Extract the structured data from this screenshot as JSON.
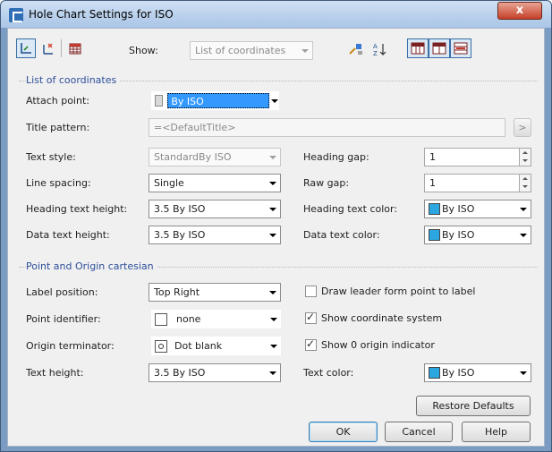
{
  "window": {
    "title": "Hole Chart Settings for ISO",
    "close_label": "x"
  },
  "toolbar": {
    "show_label": "Show:",
    "show_value": "List of coordinates",
    "sort_label": "A Z"
  },
  "section1": {
    "title": "List of coordinates",
    "attach_point": {
      "label": "Attach point:",
      "value": "By ISO"
    },
    "title_pattern": {
      "label": "Title pattern:",
      "value": "=<DefaultTitle>",
      "btn": ">"
    },
    "text_style": {
      "label": "Text style:",
      "value": "StandardBy ISO"
    },
    "heading_gap": {
      "label": "Heading gap:",
      "value": "1"
    },
    "line_spacing": {
      "label": "Line spacing:",
      "value": "Single"
    },
    "raw_gap": {
      "label": "Raw gap:",
      "value": "1"
    },
    "heading_text_height": {
      "label": "Heading text height:",
      "value": "3.5 By ISO"
    },
    "heading_text_color": {
      "label": "Heading text color:",
      "value": "By ISO",
      "color": "#2aa7e0"
    },
    "data_text_height": {
      "label": "Data text height:",
      "value": "3.5 By ISO"
    },
    "data_text_color": {
      "label": "Data text color:",
      "value": "By ISO",
      "color": "#2aa7e0"
    }
  },
  "section2": {
    "title": "Point and Origin cartesian",
    "label_position": {
      "label": "Label position:",
      "value": "Top Right"
    },
    "draw_leader": {
      "label": "Draw leader form point to label",
      "checked": false
    },
    "point_identifier": {
      "label": "Point identifier:",
      "value": "none"
    },
    "show_coord": {
      "label": "Show coordinate system",
      "checked": true
    },
    "origin_terminator": {
      "label": "Origin terminator:",
      "value": "Dot blank"
    },
    "show_origin": {
      "label": "Show 0 origin indicator",
      "checked": true
    },
    "text_height": {
      "label": "Text height:",
      "value": "3.5 By ISO"
    },
    "text_color": {
      "label": "Text color:",
      "value": "By ISO",
      "color": "#2aa7e0"
    }
  },
  "buttons": {
    "restore": "Restore Defaults",
    "ok": "OK",
    "cancel": "Cancel",
    "help": "Help"
  },
  "colors": {
    "title_bar": "#b8d0ec",
    "section_title": "#2d4f9a",
    "selection": "#3399ff"
  }
}
